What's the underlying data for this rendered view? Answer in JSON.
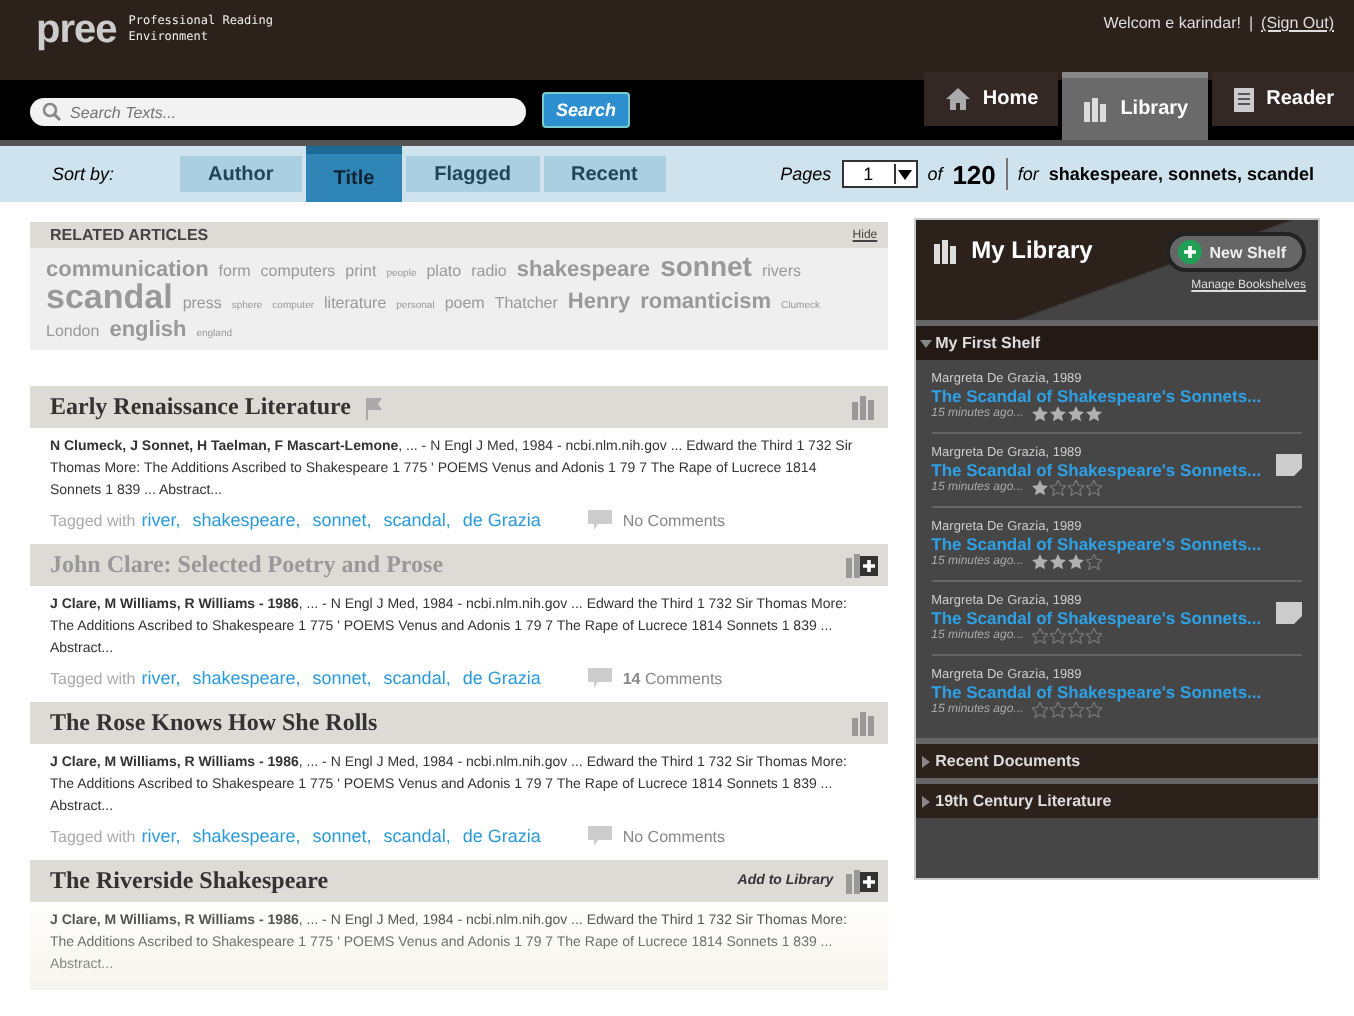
{
  "logo": {
    "text": "pree",
    "tagline": "Professional Reading Environment"
  },
  "user": {
    "welcome": "Welcom e karindar!",
    "separator": "|",
    "sign_out": "(Sign Out)"
  },
  "search": {
    "placeholder": "Search Texts...",
    "button": "Search"
  },
  "nav_tabs": [
    {
      "label": "Home",
      "selected": false
    },
    {
      "label": "Library",
      "selected": true
    },
    {
      "label": "Reader",
      "selected": false
    }
  ],
  "sort": {
    "label": "Sort by:",
    "options": [
      {
        "label": "Author",
        "selected": false
      },
      {
        "label": "Title",
        "selected": true
      },
      {
        "label": "Flagged",
        "selected": false
      },
      {
        "label": "Recent",
        "selected": false
      }
    ]
  },
  "pager": {
    "label": "Pages",
    "value": "1",
    "of": "of",
    "total": "120",
    "query_prefix": "for",
    "query": "shakespeare, sonnets, scandel"
  },
  "related": {
    "title": "RELATED ARTICLES",
    "hide": "Hide",
    "tags": [
      {
        "text": "communication",
        "kind": "m"
      },
      {
        "text": "form",
        "kind": "s"
      },
      {
        "text": "computers",
        "kind": "s"
      },
      {
        "text": "print",
        "kind": "s"
      },
      {
        "text": "people",
        "kind": "xs"
      },
      {
        "text": "plato",
        "kind": "s"
      },
      {
        "text": "radio",
        "kind": "s"
      },
      {
        "text": "shakespeare",
        "kind": "m"
      },
      {
        "text": "sonnet",
        "kind": "l"
      },
      {
        "text": "rivers",
        "kind": "s"
      },
      {
        "text": "scandal",
        "kind": "xl"
      },
      {
        "text": "press",
        "kind": "s"
      },
      {
        "text": "sphere",
        "kind": "xs"
      },
      {
        "text": "computer",
        "kind": "xs"
      },
      {
        "text": "literature",
        "kind": "s"
      },
      {
        "text": "personal",
        "kind": "xs"
      },
      {
        "text": "poem",
        "kind": "s"
      },
      {
        "text": "Thatcher",
        "kind": "s"
      },
      {
        "text": "Henry",
        "kind": "m"
      },
      {
        "text": "romanticism",
        "kind": "m"
      },
      {
        "text": "Clumeck",
        "kind": "xs"
      },
      {
        "text": "London",
        "kind": "s"
      },
      {
        "text": "english",
        "kind": "m"
      },
      {
        "text": "england",
        "kind": "xs"
      }
    ]
  },
  "articles": [
    {
      "title": "Early Renaissance Literature",
      "dimmed": false,
      "flagged": true,
      "in_library": true,
      "abstract": "**N Clumeck, J Sonnet, H Taelman, F Mascart-Lemone**, ... - N Engl J Med, 1984 - ncbi.nlm.nih.gov ... Edward the Third 1 732 Sir Thomas More: The Additions Ascribed to Shakespeare 1 775 ' POEMS Venus and Adonis 1 79 7 The Rape of Lucrece 1814 Sonnets 1 839 ... Abstract...",
      "tagged_label": "Tagged with",
      "tags": [
        "river,",
        "shakespeare,",
        "sonnet,",
        "scandal,",
        "de Grazia"
      ],
      "comments": "No Comments"
    },
    {
      "title": "John Clare: Selected Poetry and Prose",
      "dimmed": true,
      "flagged": false,
      "in_library": false,
      "abstract": "**J Clare, M Williams, R Williams - 1986**, ... - N Engl J Med, 1984 - ncbi.nlm.nih.gov ... Edward the Third 1 732 Sir Thomas More: The Additions Ascribed to Shakespeare 1 775 ' POEMS Venus and Adonis 1 79 7 The Rape of Lucrece 1814 Sonnets 1 839 ... Abstract...",
      "tagged_label": "Tagged with",
      "tags": [
        "river,",
        "shakespeare,",
        "sonnet,",
        "scandal,",
        "de Grazia"
      ],
      "comments": "**14** Comments"
    },
    {
      "title": "The Rose Knows How She Rolls",
      "dimmed": false,
      "flagged": false,
      "in_library": true,
      "abstract": "**J Clare, M Williams, R Williams - 1986**, ... - N Engl J Med, 1984 - ncbi.nlm.nih.gov ... Edward the Third 1 732 Sir Thomas More: The Additions Ascribed to Shakespeare 1 775 ' POEMS Venus and Adonis 1 79 7 The Rape of Lucrece 1814 Sonnets 1 839 ... Abstract...",
      "tagged_label": "Tagged with",
      "tags": [
        "river,",
        "shakespeare,",
        "sonnet,",
        "scandal,",
        "de Grazia"
      ],
      "comments": "No Comments"
    },
    {
      "title": "The Riverside Shakespeare",
      "dimmed": false,
      "flagged": false,
      "in_library": false,
      "action": "Add to Library",
      "abstract": "**J Clare, M Williams, R Williams - 1986**, ... - N Engl J Med, 1984 - ncbi.nlm.nih.gov ... Edward the Third 1 732 Sir Thomas More: The Additions Ascribed to Shakespeare 1 775 ' POEMS Venus and Adonis 1 79 7 The Rape of Lucrece 1814 Sonnets 1 839 ... Abstract..."
    }
  ],
  "library": {
    "title": "My Library",
    "new_shelf": "New Shelf",
    "manage": "Manage Bookshelves",
    "shelves": [
      {
        "name": "My First Shelf",
        "expanded": true,
        "items": [
          {
            "author": "Margreta De Grazia, 1989",
            "title": "The Scandal of Shakespeare's Sonnets...",
            "time": "15 minutes ago...",
            "stars": 4,
            "note": false
          },
          {
            "author": "Margreta De Grazia, 1989",
            "title": "The Scandal of Shakespeare's Sonnets...",
            "time": "15 minutes ago...",
            "stars": 1,
            "note": true
          },
          {
            "author": "Margreta De Grazia, 1989",
            "title": "The Scandal of Shakespeare's Sonnets...",
            "time": "15 minutes ago...",
            "stars": 3,
            "note": false
          },
          {
            "author": "Margreta De Grazia, 1989",
            "title": "The Scandal of Shakespeare's Sonnets...",
            "time": "15 minutes ago...",
            "stars": 0,
            "note": true
          },
          {
            "author": "Margreta De Grazia, 1989",
            "title": "The Scandal of Shakespeare's Sonnets...",
            "time": "15 minutes ago...",
            "stars": 0,
            "note": false
          }
        ]
      },
      {
        "name": "Recent Documents",
        "expanded": false
      },
      {
        "name": "19th Century Literature",
        "expanded": false
      }
    ]
  }
}
